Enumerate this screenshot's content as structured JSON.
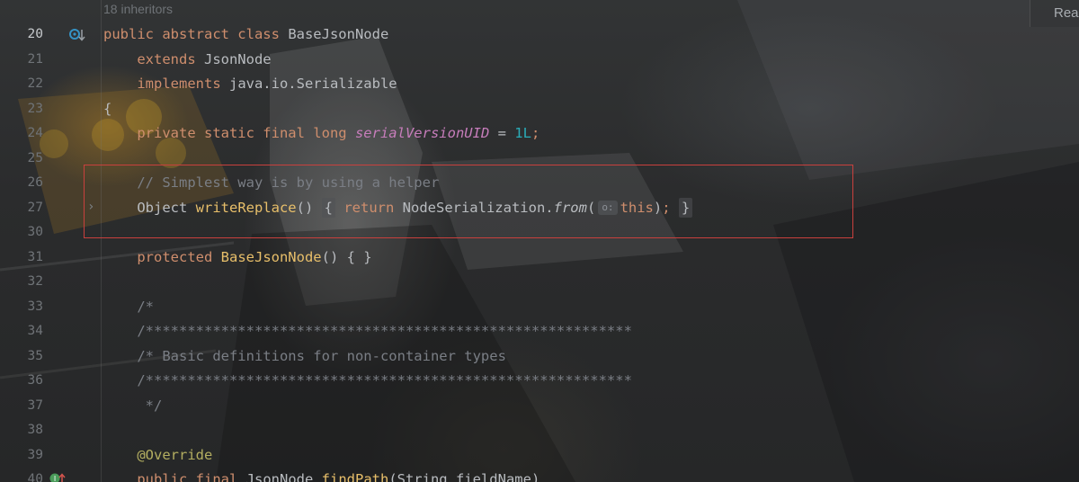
{
  "editor": {
    "inheritors_hint": "18 inheritors",
    "reader_mode_label": "Rea",
    "lines": [
      {
        "num": "20",
        "parts": [
          [
            "kw",
            "public abstract class "
          ],
          [
            "cls",
            "BaseJsonNode"
          ]
        ]
      },
      {
        "num": "21",
        "parts": [
          [
            "pad",
            "    "
          ],
          [
            "kw",
            "extends "
          ],
          [
            "cls",
            "JsonNode"
          ]
        ]
      },
      {
        "num": "22",
        "parts": [
          [
            "pad",
            "    "
          ],
          [
            "kw",
            "implements "
          ],
          [
            "cls",
            "java.io.Serializable"
          ]
        ]
      },
      {
        "num": "23",
        "parts": [
          [
            "cls",
            "{"
          ]
        ]
      },
      {
        "num": "24",
        "parts": [
          [
            "pad",
            "    "
          ],
          [
            "kw",
            "private static final long "
          ],
          [
            "static-f",
            "serialVersionUID"
          ],
          [
            "cls",
            " = "
          ],
          [
            "num",
            "1L"
          ],
          [
            "kw",
            ";"
          ]
        ]
      },
      {
        "num": "25",
        "parts": []
      },
      {
        "num": "26",
        "parts": [
          [
            "pad",
            "    "
          ],
          [
            "cmt",
            "// Simplest way is by using a helper"
          ]
        ]
      },
      {
        "num": "27",
        "parts": [
          [
            "pad",
            "    "
          ],
          [
            "cls",
            "Object "
          ],
          [
            "fn-y",
            "writeReplace"
          ],
          [
            "cls",
            "() "
          ],
          [
            "fold",
            "{"
          ],
          [
            "cls",
            " "
          ],
          [
            "kw",
            "return "
          ],
          [
            "cls",
            "NodeSerialization."
          ],
          [
            "ital",
            "from"
          ],
          [
            "cls",
            "("
          ],
          [
            "hint",
            "o:"
          ],
          [
            "kw",
            "this"
          ],
          [
            "cls",
            ")"
          ],
          [
            "kw",
            ";"
          ],
          [
            "cls",
            " "
          ],
          [
            "fold",
            "}"
          ]
        ]
      },
      {
        "num": "30",
        "parts": []
      },
      {
        "num": "31",
        "parts": [
          [
            "pad",
            "    "
          ],
          [
            "kw",
            "protected "
          ],
          [
            "fn-y",
            "BaseJsonNode"
          ],
          [
            "cls",
            "() { }"
          ]
        ]
      },
      {
        "num": "32",
        "parts": []
      },
      {
        "num": "33",
        "parts": [
          [
            "pad",
            "    "
          ],
          [
            "cmt",
            "/*"
          ]
        ]
      },
      {
        "num": "34",
        "parts": [
          [
            "pad",
            "    "
          ],
          [
            "cmt",
            "/**********************************************************"
          ]
        ]
      },
      {
        "num": "35",
        "parts": [
          [
            "pad",
            "    "
          ],
          [
            "cmt",
            "/* Basic definitions for non-container types"
          ]
        ]
      },
      {
        "num": "36",
        "parts": [
          [
            "pad",
            "    "
          ],
          [
            "cmt",
            "/**********************************************************"
          ]
        ]
      },
      {
        "num": "37",
        "parts": [
          [
            "pad",
            "    "
          ],
          [
            "cmt",
            " */"
          ]
        ]
      },
      {
        "num": "38",
        "parts": []
      },
      {
        "num": "39",
        "parts": [
          [
            "pad",
            "    "
          ],
          [
            "ann",
            "@Override"
          ]
        ]
      },
      {
        "num": "40",
        "parts": [
          [
            "pad",
            "    "
          ],
          [
            "kw",
            "public final "
          ],
          [
            "cls",
            "JsonNode "
          ],
          [
            "fn-y",
            "findPath"
          ],
          [
            "cls",
            "(String fieldName)"
          ]
        ]
      }
    ],
    "current_line": "20",
    "gutter_icons": {
      "20": "implemented-down-icon",
      "40": "override-up-icon"
    },
    "highlight_color": "#c9403d"
  }
}
